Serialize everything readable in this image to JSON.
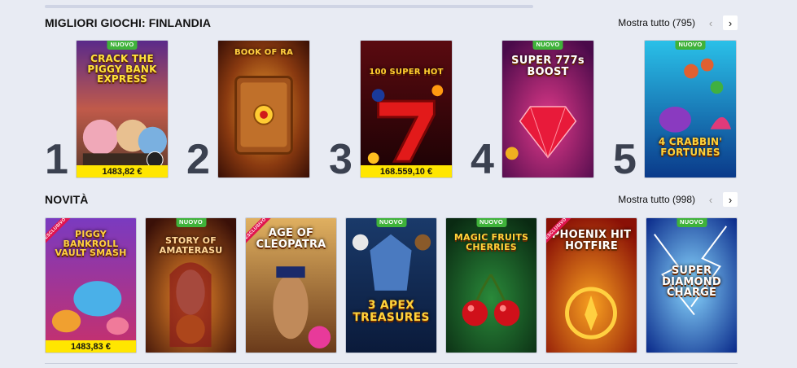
{
  "sections": {
    "top": {
      "title": "MIGLIORI GIOCHI: FINLANDIA",
      "show_all": "Mostra tutto (795)",
      "prev_icon": "chevron-left-icon",
      "next_icon": "chevron-right-icon",
      "games": [
        {
          "rank": "1",
          "title": "CRACK THE PIGGY BANK EXPRESS",
          "badge": "NUOVO",
          "jackpot": "1483,82 €"
        },
        {
          "rank": "2",
          "title": "BOOK OF RA",
          "badge": "",
          "jackpot": ""
        },
        {
          "rank": "3",
          "title": "100 SUPER HOT",
          "badge": "",
          "jackpot": "168.559,10 €"
        },
        {
          "rank": "4",
          "title": "SUPER 777s BOOST",
          "badge": "NUOVO",
          "jackpot": ""
        },
        {
          "rank": "5",
          "title": "4 CRABBIN' FORTUNES",
          "badge": "NUOVO",
          "jackpot": ""
        }
      ]
    },
    "new": {
      "title": "NOVITÀ",
      "show_all": "Mostra tutto (998)",
      "games": [
        {
          "title": "PIGGY BANKROLL VAULT SMASH",
          "badge": "",
          "exclusive": "ESCLUSIVO",
          "jackpot": "1483,83 €"
        },
        {
          "title": "STORY OF AMATERASU",
          "badge": "NUOVO",
          "exclusive": "",
          "jackpot": ""
        },
        {
          "title": "AGE OF CLEOPATRA",
          "badge": "",
          "exclusive": "ESCLUSIVO",
          "jackpot": ""
        },
        {
          "title": "3 APEX TREASURES",
          "badge": "NUOVO",
          "exclusive": "",
          "jackpot": ""
        },
        {
          "title": "MAGIC FRUITS CHERRIES",
          "badge": "NUOVO",
          "exclusive": "",
          "jackpot": ""
        },
        {
          "title": "PHOENIX HIT HOTFIRE",
          "badge": "",
          "exclusive": "ESCLUSIVO",
          "jackpot": ""
        },
        {
          "title": "SUPER DIAMOND CHARGE",
          "badge": "NUOVO",
          "exclusive": "",
          "jackpot": ""
        }
      ]
    }
  },
  "colors": {
    "background": "#e8ebf3",
    "jackpot_bar": "#ffe600",
    "new_badge": "#3fb23a",
    "exclusive_badge": "#e0144f",
    "rank_number": "#3b4150"
  }
}
